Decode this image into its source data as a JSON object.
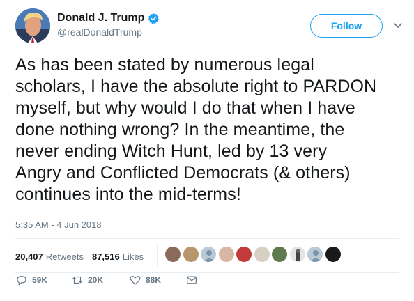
{
  "user": {
    "display_name": "Donald J. Trump",
    "handle": "@realDonaldTrump",
    "verified": true,
    "avatar_icon": "profile-photo"
  },
  "follow_label": "Follow",
  "tweet": {
    "text": "As has been stated by numerous legal\nscholars, I have the absolute right to PARDON\nmyself, but why would I do that when I have\ndone nothing wrong? In the meantime, the\nnever ending Witch Hunt, led by 13 very\nAngry and Conflicted Democrats (& others)\ncontinues into the mid-terms!",
    "timestamp": "5:35 AM - 4 Jun 2018"
  },
  "stats": {
    "retweets_count": "20,407",
    "retweets_label": "Retweets",
    "likes_count": "87,516",
    "likes_label": "Likes"
  },
  "likers_count_shown": 10,
  "actions": {
    "reply_count": "59K",
    "retweet_count": "20K",
    "like_count": "88K"
  },
  "colors": {
    "accent": "#1da1f2",
    "secondary_text": "#657786",
    "primary_text": "#14171a",
    "divider": "#e6ecf0"
  }
}
